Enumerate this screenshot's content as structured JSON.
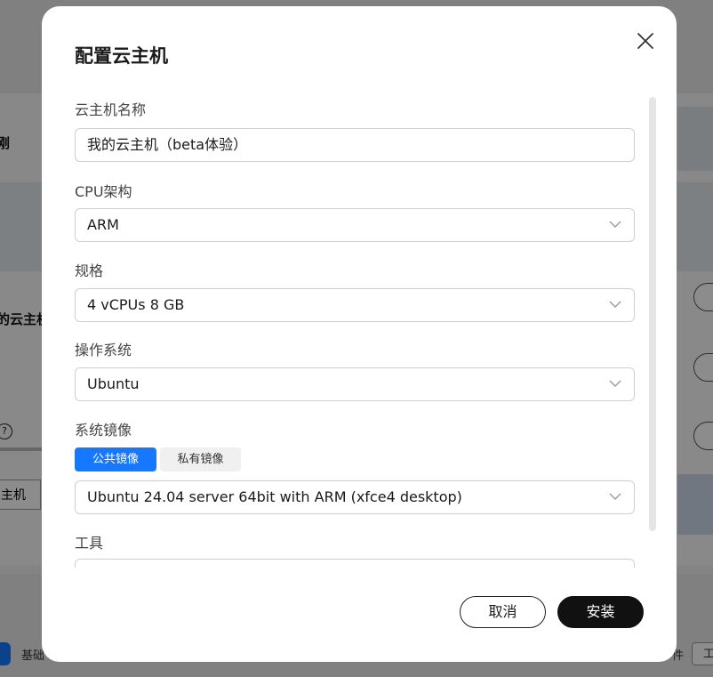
{
  "background": {
    "text_1": "刚",
    "text_2": "的云主机",
    "help_glyph": "?",
    "tab_label": "主机",
    "footer_left": "基础",
    "footer_right_1": "件",
    "footer_right_2": "工"
  },
  "modal": {
    "title": "配置云主机",
    "close_icon": "close-icon",
    "fields": {
      "name": {
        "label": "云主机名称",
        "value": "我的云主机（beta体验）"
      },
      "cpu_arch": {
        "label": "CPU架构",
        "value": "ARM"
      },
      "spec": {
        "label": "规格",
        "value": "4 vCPUs 8 GB"
      },
      "os": {
        "label": "操作系统",
        "value": "Ubuntu"
      },
      "image": {
        "label": "系统镜像",
        "tabs": {
          "public": "公共镜像",
          "private": "私有镜像"
        },
        "active_tab": "公共镜像",
        "value": "Ubuntu 24.04 server 64bit with ARM (xfce4 desktop)"
      },
      "tools": {
        "label": "工具"
      }
    },
    "buttons": {
      "cancel": "取消",
      "install": "安装"
    }
  },
  "colors": {
    "accent": "#1677ff",
    "primary_button": "#111111"
  }
}
